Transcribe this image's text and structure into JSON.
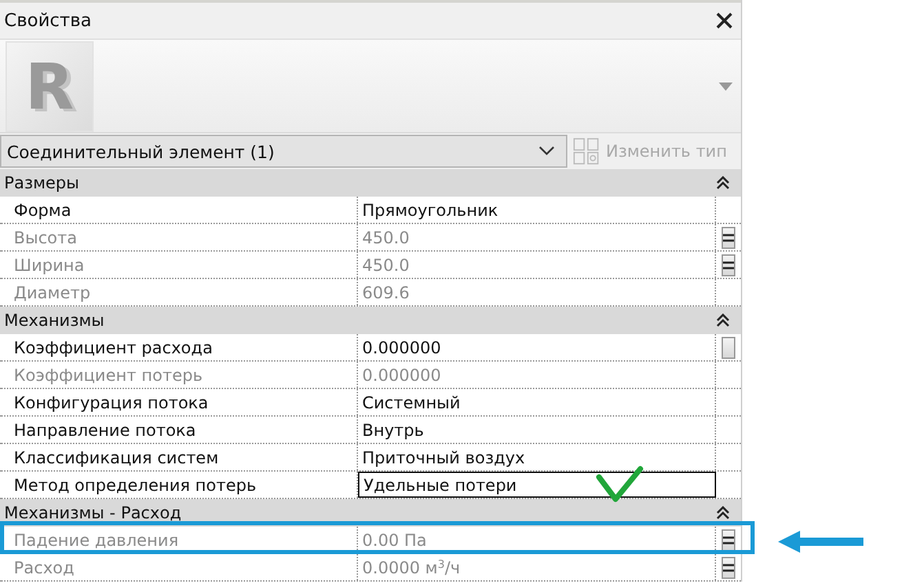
{
  "panel": {
    "title": "Свойства",
    "preview_logo": "R",
    "type_selector": "Соединительный элемент (1)",
    "edit_type_button": {
      "label": "Изменить тип",
      "disabled": true
    }
  },
  "sections": [
    {
      "title": "Размеры",
      "expanded": true,
      "rows": [
        {
          "name": "Форма",
          "value": "Прямоугольник",
          "disabled": false,
          "button": false,
          "associated": false
        },
        {
          "name": "Высота",
          "value": "450.0",
          "disabled": true,
          "button": true,
          "associated": true
        },
        {
          "name": "Ширина",
          "value": "450.0",
          "disabled": true,
          "button": true,
          "associated": true
        },
        {
          "name": "Диаметр",
          "value": "609.6",
          "disabled": true,
          "button": false,
          "associated": false
        }
      ]
    },
    {
      "title": "Механизмы",
      "expanded": true,
      "rows": [
        {
          "name": "Коэффициент расхода",
          "value": "0.000000",
          "disabled": false,
          "button": true,
          "associated": false
        },
        {
          "name": "Коэффициент потерь",
          "value": "0.000000",
          "disabled": true,
          "button": false,
          "associated": false
        },
        {
          "name": "Конфигурация потока",
          "value": "Системный",
          "disabled": false,
          "button": false,
          "associated": false
        },
        {
          "name": "Направление потока",
          "value": "Внутрь",
          "disabled": false,
          "button": false,
          "associated": false
        },
        {
          "name": "Классификация систем",
          "value": "Приточный воздух",
          "disabled": false,
          "button": false,
          "associated": false
        },
        {
          "name": "Метод определения потерь",
          "value": "Удельные потери",
          "disabled": false,
          "editing": true,
          "button": false,
          "associated": false
        }
      ]
    },
    {
      "title": "Механизмы - Расход",
      "expanded": true,
      "rows": [
        {
          "name": "Падение давления",
          "value": "0.00 Па",
          "disabled": true,
          "button": true,
          "associated": true
        },
        {
          "name": "Расход",
          "value": "0.0000 м$^{3}$/ч",
          "disabled": true,
          "button": true,
          "associated": true
        }
      ]
    }
  ]
}
